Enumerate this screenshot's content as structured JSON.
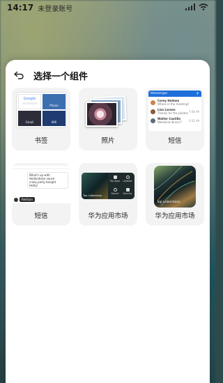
{
  "status_bar": {
    "time": "14:17",
    "carrier": "未登录账号"
  },
  "sheet": {
    "title": "选择一个组件"
  },
  "widgets": [
    {
      "label": "书签"
    },
    {
      "label": "照片"
    },
    {
      "label": "短信"
    },
    {
      "label": "短信"
    },
    {
      "label": "华为应用市场"
    },
    {
      "label": "华为应用市场"
    }
  ],
  "bookmarks_preview": {
    "tiles": [
      "Google",
      "Phone",
      "Gmail",
      "Wifi"
    ]
  },
  "messenger_preview": {
    "header": "Messenger",
    "contacts": [
      {
        "name": "Corey Holmes",
        "snippet": "Where is the meeting?",
        "color": "#c9844a"
      },
      {
        "name": "Lisa Larsen",
        "snippet": "Thanks for the photos",
        "color": "#8b5a3c",
        "time": "7:58 AM"
      },
      {
        "name": "Walter Castillo",
        "snippet": "Weekend dinner?",
        "color": "#5f6b78",
        "time": "3:42 AM"
      }
    ]
  },
  "sms_preview": {
    "lines": [
      "What's up with",
      "Hollandaise sauce",
      "crazy party tonight",
      "Hotty!"
    ],
    "author": "Redican"
  },
  "appgallery_small": {
    "tiles": [
      "Top Apps",
      "Updates",
      "Search",
      "Security"
    ],
    "caption": "Top Collections"
  },
  "appgallery_large": {
    "caption": "Top Collections"
  },
  "colors": {
    "accent": "#1e6fd9",
    "card_bg": "#f3f3f3",
    "sheet_bg": "#ffffff"
  }
}
